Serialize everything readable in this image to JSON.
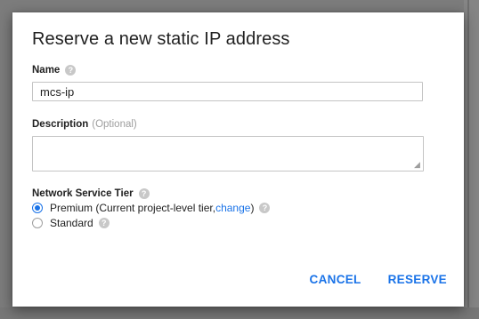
{
  "dialog": {
    "title": "Reserve a new static IP address"
  },
  "name_field": {
    "label": "Name",
    "help_icon": "?",
    "value": "mcs-ip"
  },
  "description_field": {
    "label": "Description",
    "optional_text": "(Optional)",
    "value": ""
  },
  "network_tier": {
    "label": "Network Service Tier",
    "help_icon": "?",
    "options": [
      {
        "label": "Premium (Current project-level tier, ",
        "link": "change",
        "suffix": ")",
        "selected": true
      },
      {
        "label": "Standard",
        "selected": false
      }
    ]
  },
  "actions": {
    "cancel": "CANCEL",
    "reserve": "RESERVE"
  },
  "colors": {
    "accent": "#1a73e8",
    "help_icon": "#c8c8c8",
    "muted_text": "#9e9e9e"
  }
}
